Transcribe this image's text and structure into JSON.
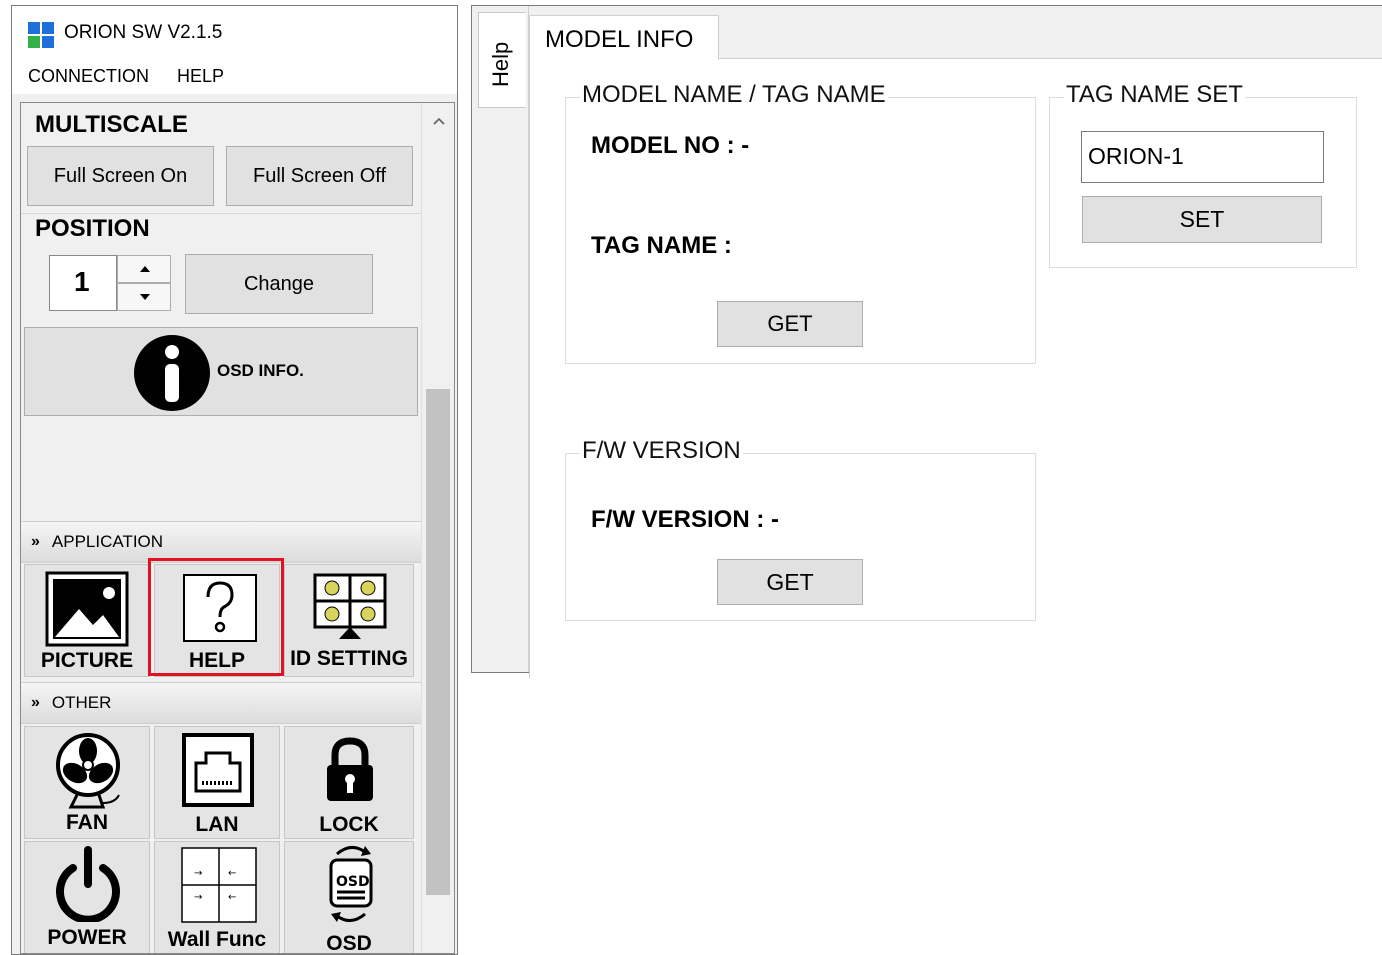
{
  "app": {
    "title": "ORION SW V2.1.5"
  },
  "menu": {
    "connection": "CONNECTION",
    "help": "HELP"
  },
  "multiscale": {
    "heading": "MULTISCALE",
    "full_screen_on": "Full Screen On",
    "full_screen_off": "Full Screen Off"
  },
  "position": {
    "heading": "POSITION",
    "value": "1",
    "change_label": "Change"
  },
  "osd_info": {
    "label": "OSD INFO."
  },
  "application": {
    "heading": "APPLICATION",
    "tiles": [
      {
        "label": "PICTURE",
        "icon": "picture-icon"
      },
      {
        "label": "HELP",
        "icon": "help-icon",
        "highlight": true
      },
      {
        "label": "ID SETTING",
        "icon": "id-setting-icon"
      }
    ]
  },
  "other": {
    "heading": "OTHER",
    "tiles": [
      {
        "label": "FAN",
        "icon": "fan-icon"
      },
      {
        "label": "LAN",
        "icon": "lan-icon"
      },
      {
        "label": "LOCK",
        "icon": "lock-icon"
      },
      {
        "label": "POWER",
        "icon": "power-icon"
      },
      {
        "label": "Wall Func",
        "icon": "wall-func-icon"
      },
      {
        "label": "OSD",
        "icon": "osd-icon"
      }
    ]
  },
  "help_panel": {
    "side_tab": "Help",
    "tab": "MODEL INFO",
    "model_group": {
      "title": "MODEL NAME / TAG NAME",
      "model_no_label": "MODEL NO : -",
      "tag_name_label": "TAG NAME :",
      "get_label": "GET"
    },
    "tag_set_group": {
      "title": "TAG NAME SET",
      "input_value": "ORION-1",
      "set_label": "SET"
    },
    "fw_group": {
      "title": "F/W VERSION",
      "fw_label": "F/W VERSION :  -",
      "get_label": "GET"
    }
  },
  "colors": {
    "highlight": "#e0141e",
    "logo_blue": "#1e6fd9",
    "logo_green": "#33b249"
  }
}
